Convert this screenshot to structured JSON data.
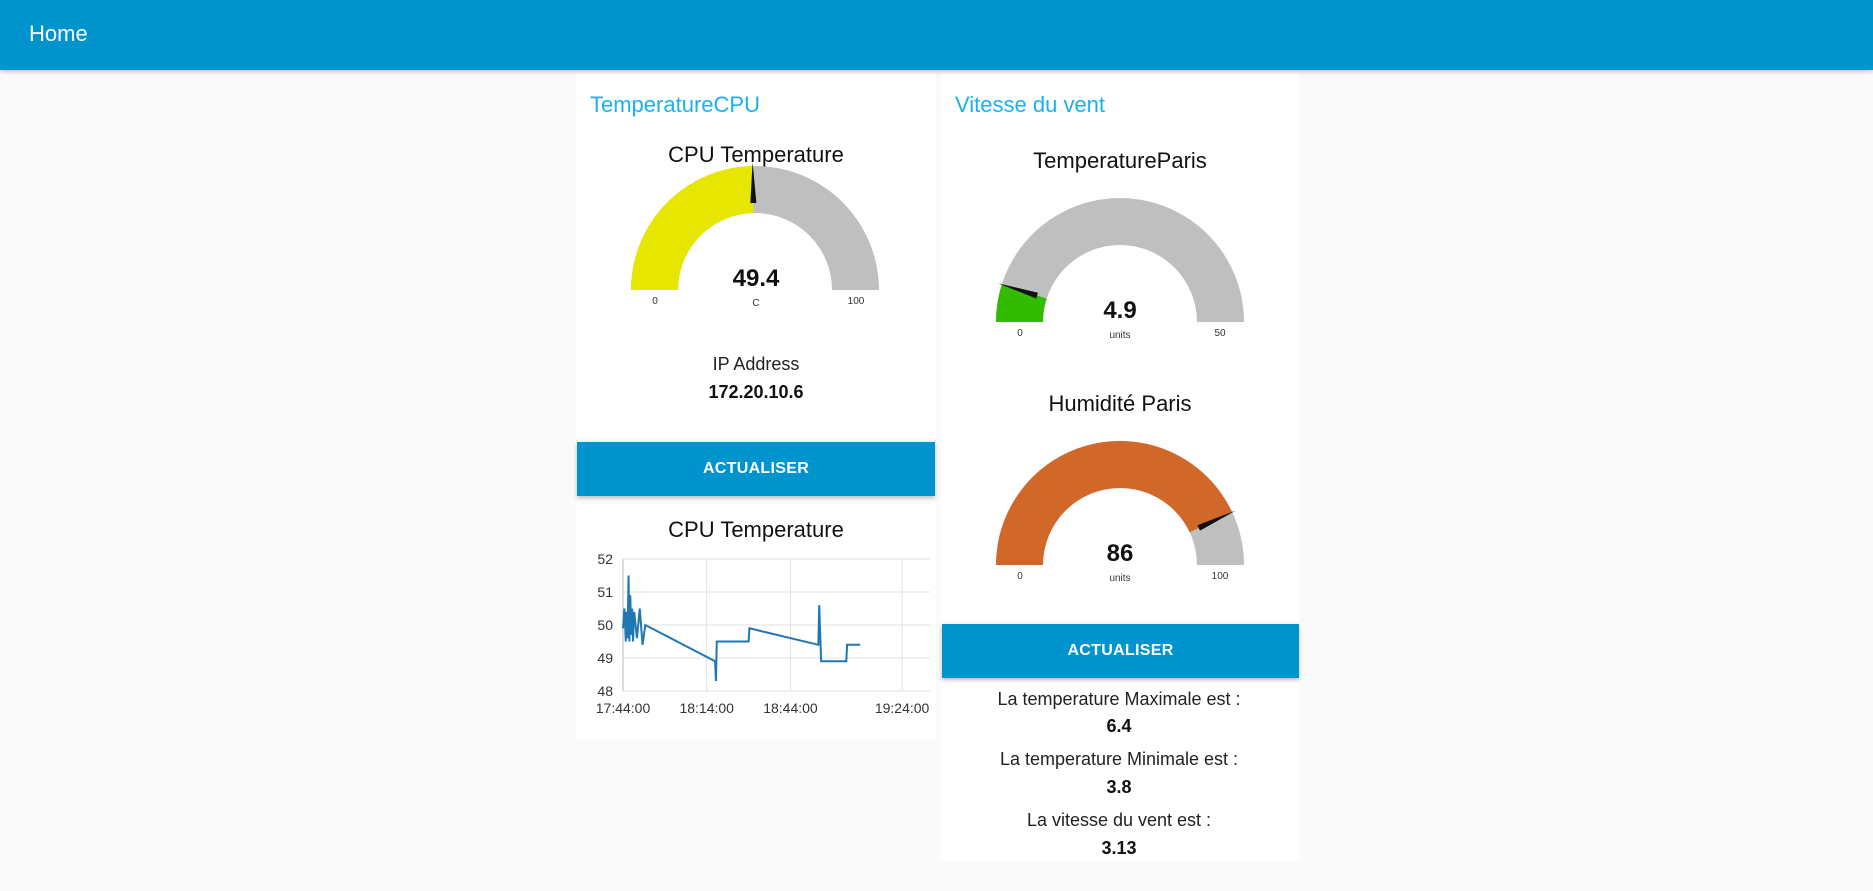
{
  "header": {
    "title": "Home"
  },
  "left_group": {
    "title": "TemperatureCPU",
    "gauge": {
      "title": "CPU Temperature",
      "value": "49.4",
      "value_num": 49.4,
      "unit": "C",
      "min": "0",
      "max": "100",
      "min_num": 0,
      "max_num": 100,
      "fill_color": "#e6e600",
      "track_color": "#bfbfbf"
    },
    "ip_label": "IP Address",
    "ip_value": "172.20.10.6",
    "button_label": "ACTUALISER",
    "chart_title": "CPU Temperature"
  },
  "right_group": {
    "title": "Vitesse du vent",
    "gauge_temp": {
      "title": "TemperatureParis",
      "value": "4.9",
      "value_num": 4.9,
      "unit": "units",
      "min": "0",
      "max": "50",
      "min_num": 0,
      "max_num": 50,
      "fill_color": "#33bb00",
      "track_color": "#bfbfbf"
    },
    "gauge_hum": {
      "title": "Humidité Paris",
      "value": "86",
      "value_num": 86,
      "unit": "units",
      "min": "0",
      "max": "100",
      "min_num": 0,
      "max_num": 100,
      "fill_color": "#d2672a",
      "track_color": "#bfbfbf"
    },
    "button_label": "ACTUALISER",
    "max_label": "La temperature Maximale est :",
    "max_value": "6.4",
    "min_label": "La temperature Minimale est :",
    "min_value": "3.8",
    "wind_label": "La vitesse du vent est :",
    "wind_value": "3.13"
  },
  "chart_data": {
    "type": "line",
    "title": "CPU Temperature",
    "xlabel": "",
    "ylabel": "",
    "ylim": [
      48,
      52
    ],
    "y_ticks": [
      "52",
      "51",
      "50",
      "49",
      "48"
    ],
    "x_ticks": [
      "17:44:00",
      "18:14:00",
      "18:44:00",
      "19:24:00"
    ],
    "x_tick_minutes": [
      0,
      30,
      60,
      100
    ],
    "xlim_minutes": [
      0,
      110
    ],
    "grid": true,
    "line_color": "#1f77b4",
    "series": [
      {
        "x_minutes": [
          0,
          0.5,
          1,
          1.3,
          1.6,
          2,
          2.3,
          2.6,
          3,
          3.3,
          3.6,
          4,
          4.5,
          5,
          6,
          7,
          8,
          33,
          33.3,
          33.6,
          45,
          45.3,
          70,
          70.3,
          71,
          73,
          80,
          80.3,
          85
        ],
        "values": [
          49.9,
          50.5,
          49.5,
          50.4,
          49.6,
          51.5,
          49.5,
          50.9,
          49.7,
          50.5,
          49.5,
          50.4,
          50.0,
          49.6,
          50.5,
          49.4,
          50.0,
          48.9,
          48.3,
          49.5,
          49.5,
          49.9,
          49.4,
          50.6,
          48.9,
          48.9,
          48.9,
          49.4,
          49.4
        ]
      }
    ]
  }
}
